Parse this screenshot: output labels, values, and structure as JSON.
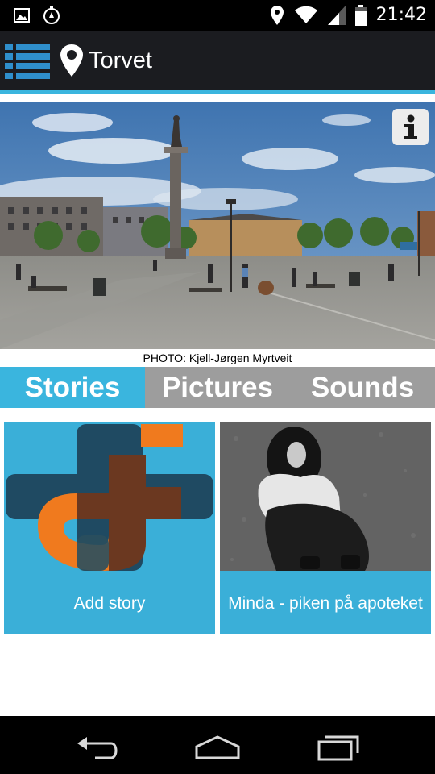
{
  "status_bar": {
    "time": "21:42",
    "left_icons": [
      "image-icon",
      "timer-icon"
    ],
    "right_icons": [
      "location-icon",
      "wifi-icon",
      "signal-icon",
      "battery-icon"
    ]
  },
  "app_bar": {
    "title": "Torvet",
    "icons": [
      "menu-list-icon",
      "map-pin-icon"
    ]
  },
  "hero": {
    "photo_credit": "PHOTO: Kjell-Jørgen Myrtveit",
    "info_icon": "info-icon"
  },
  "tabs": [
    {
      "label": "Stories",
      "active": true
    },
    {
      "label": "Pictures",
      "active": false
    },
    {
      "label": "Sounds",
      "active": false
    }
  ],
  "cards": [
    {
      "label": "Add story",
      "icon": "add-story-logo"
    },
    {
      "label": "Minda - piken på apoteket",
      "image": "photo-of-girl"
    }
  ],
  "nav_bar": {
    "icons": [
      "back-icon",
      "home-icon",
      "recent-apps-icon"
    ]
  },
  "colors": {
    "accent": "#3ab5de",
    "app_bar": "#1b1c20",
    "tab_inactive": "#9d9d9d",
    "logo_orange": "#f07a1e",
    "logo_dark": "#1f4a62"
  }
}
